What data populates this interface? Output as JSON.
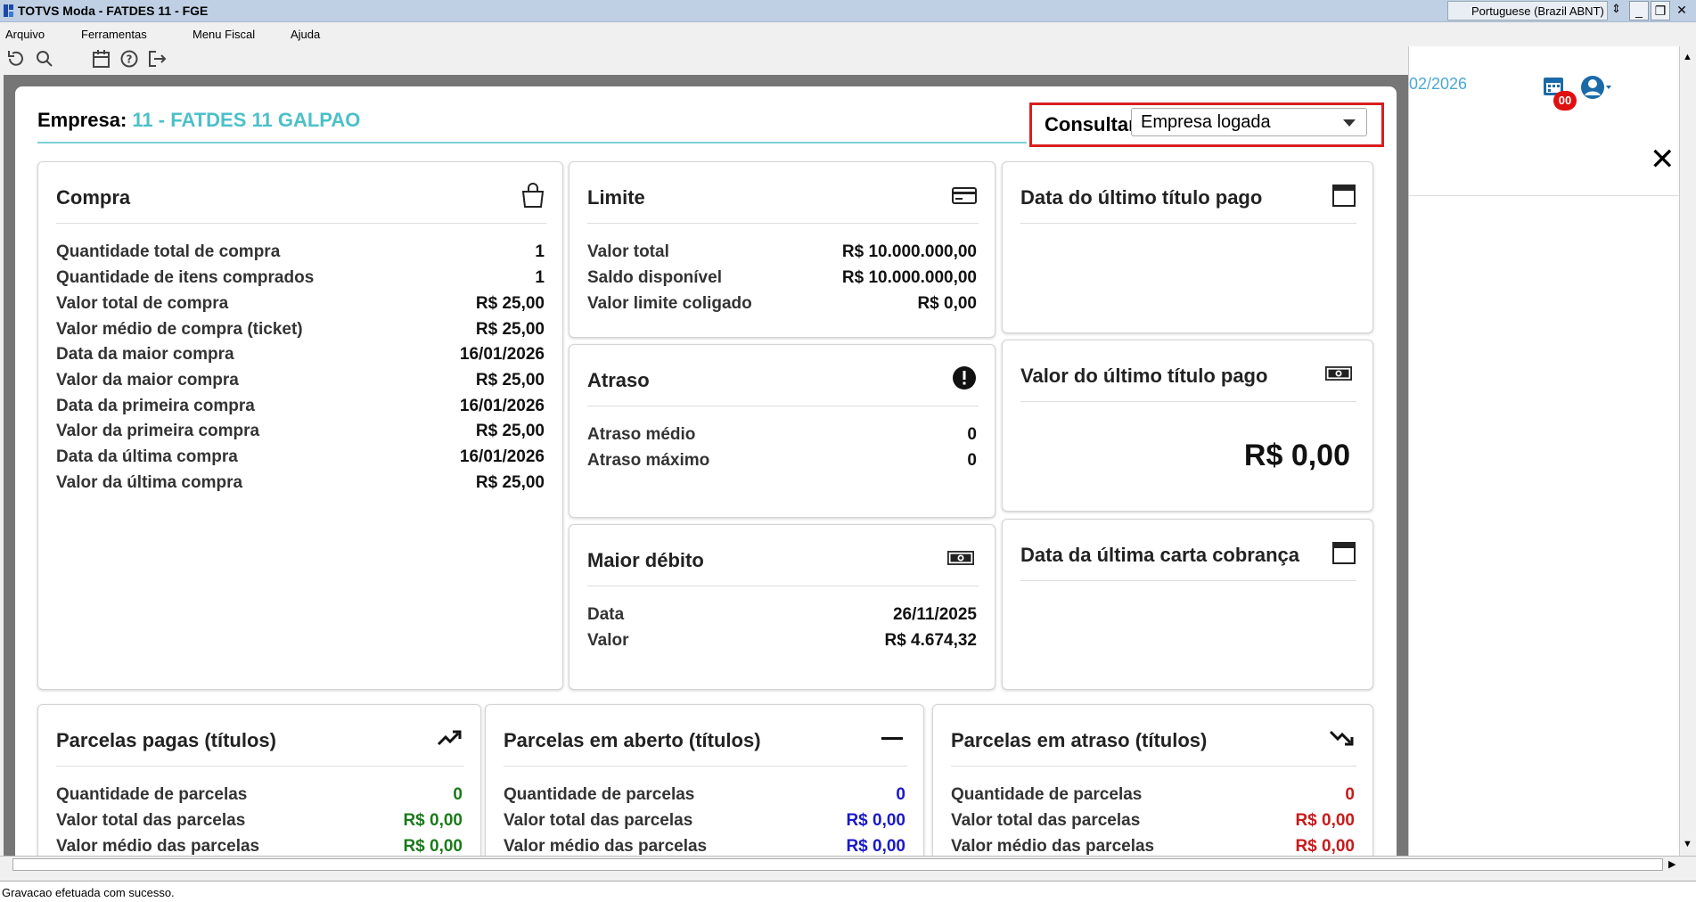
{
  "window": {
    "title": "TOTVS Moda - FATDES 11 - FGE",
    "language": "Portuguese (Brazil ABNT)"
  },
  "menu": [
    "Arquivo",
    "Ferramentas",
    "Menu Fiscal",
    "Ajuda"
  ],
  "toolbar_icons": [
    "refresh-icon",
    "search-icon",
    "calendar-icon",
    "help-icon",
    "exit-icon"
  ],
  "right_panel": {
    "date": "02/2026",
    "badge": "00"
  },
  "header": {
    "empresa_label": "Empresa:",
    "empresa_value": "11 - FATDES 11 GALPAO",
    "consultar_label": "Consultar:",
    "consultar_value": "Empresa logada"
  },
  "compra": {
    "title": "Compra",
    "rows": [
      {
        "label": "Quantidade total de compra",
        "value": "1"
      },
      {
        "label": "Quantidade de itens comprados",
        "value": "1"
      },
      {
        "label": "Valor total de compra",
        "value": "R$ 25,00"
      },
      {
        "label": "Valor médio de compra (ticket)",
        "value": "R$ 25,00"
      },
      {
        "label": "Data da maior compra",
        "value": "16/01/2026"
      },
      {
        "label": "Valor da maior compra",
        "value": "R$ 25,00"
      },
      {
        "label": "Data da primeira compra",
        "value": "16/01/2026"
      },
      {
        "label": "Valor da primeira compra",
        "value": "R$ 25,00"
      },
      {
        "label": "Data da última compra",
        "value": "16/01/2026"
      },
      {
        "label": "Valor da última compra",
        "value": "R$ 25,00"
      }
    ]
  },
  "limite": {
    "title": "Limite",
    "rows": [
      {
        "label": "Valor total",
        "value": "R$ 10.000.000,00"
      },
      {
        "label": "Saldo disponível",
        "value": "R$ 10.000.000,00"
      },
      {
        "label": "Valor limite coligado",
        "value": "R$ 0,00"
      }
    ]
  },
  "atraso": {
    "title": "Atraso",
    "rows": [
      {
        "label": "Atraso médio",
        "value": "0"
      },
      {
        "label": "Atraso máximo",
        "value": "0"
      }
    ]
  },
  "maior_debito": {
    "title": "Maior débito",
    "rows": [
      {
        "label": "Data",
        "value": "26/11/2025"
      },
      {
        "label": "Valor",
        "value": "R$ 4.674,32"
      }
    ]
  },
  "data_ultimo_titulo": {
    "title": "Data do último título pago"
  },
  "valor_ultimo_titulo": {
    "title": "Valor do último título pago",
    "value": "R$ 0,00"
  },
  "data_ultima_carta": {
    "title": "Data da última carta cobrança"
  },
  "parcelas_pagas": {
    "title": "Parcelas pagas (títulos)",
    "rows": [
      {
        "label": "Quantidade de parcelas",
        "value": "0"
      },
      {
        "label": "Valor total das parcelas",
        "value": "R$ 0,00"
      },
      {
        "label": "Valor médio das parcelas",
        "value": "R$ 0,00"
      }
    ]
  },
  "parcelas_aberto": {
    "title": "Parcelas em aberto (títulos)",
    "rows": [
      {
        "label": "Quantidade de parcelas",
        "value": "0"
      },
      {
        "label": "Valor total das parcelas",
        "value": "R$ 0,00"
      },
      {
        "label": "Valor médio das parcelas",
        "value": "R$ 0,00"
      }
    ]
  },
  "parcelas_atraso": {
    "title": "Parcelas em atraso (títulos)",
    "rows": [
      {
        "label": "Quantidade de parcelas",
        "value": "0"
      },
      {
        "label": "Valor total das parcelas",
        "value": "R$ 0,00"
      },
      {
        "label": "Valor médio das parcelas",
        "value": "R$ 0,00"
      }
    ]
  },
  "status": "Gravacao efetuada com sucesso.",
  "colors": {
    "accent": "#4cc0c8",
    "highlight": "#d81e1e",
    "green": "#1a7a1a",
    "blue": "#1a1ac8",
    "red": "#c81a1a"
  }
}
